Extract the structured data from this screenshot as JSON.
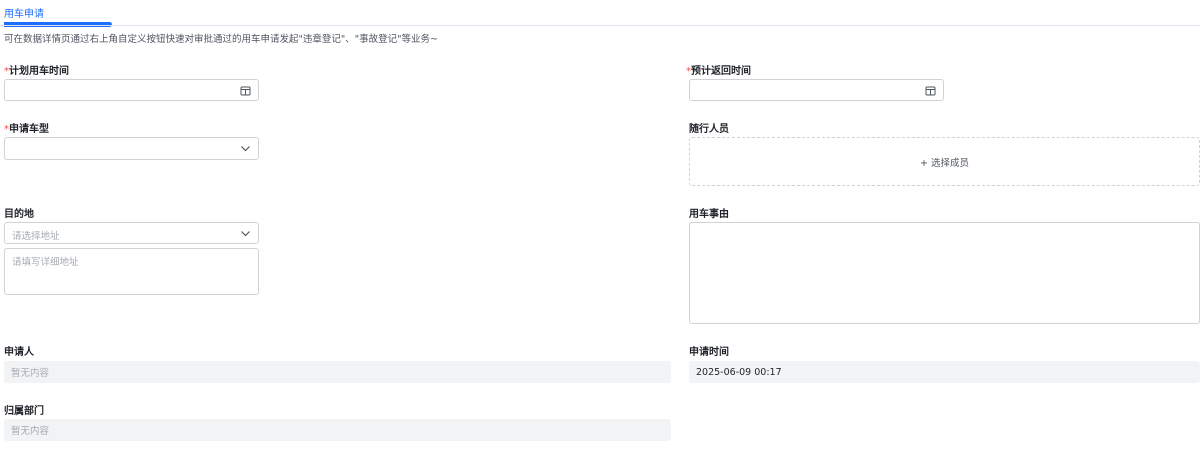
{
  "tab": {
    "title": "用车申请"
  },
  "hint": "可在数据详情页通过右上角自定义按钮快速对审批通过的用车申请发起\"违章登记\"、\"事故登记\"等业务~",
  "fields": {
    "plan_time": {
      "required_mark": "*",
      "label": "计划用车时间",
      "icon": "calendar-icon"
    },
    "return_time": {
      "required_mark": "*",
      "label": "预计返回时间",
      "icon": "calendar-icon"
    },
    "car_type": {
      "required_mark": "*",
      "label": "申请车型",
      "icon": "chevron-down-icon"
    },
    "companions": {
      "label": "随行人员",
      "button": "+ 选择成员"
    },
    "destination": {
      "label": "目的地",
      "address_placeholder": "请选择地址",
      "detail_placeholder": "请填写详细地址",
      "icon": "chevron-down-icon"
    },
    "reason": {
      "label": "用车事由"
    },
    "applicant": {
      "label": "申请人",
      "value": "暂无内容"
    },
    "apply_time": {
      "label": "申请时间",
      "value": "2025-06-09 00:17"
    },
    "department": {
      "label": "归属部门",
      "value": "暂无内容"
    }
  },
  "colors": {
    "accent": "#1e6fff",
    "required": "#f54a45"
  }
}
